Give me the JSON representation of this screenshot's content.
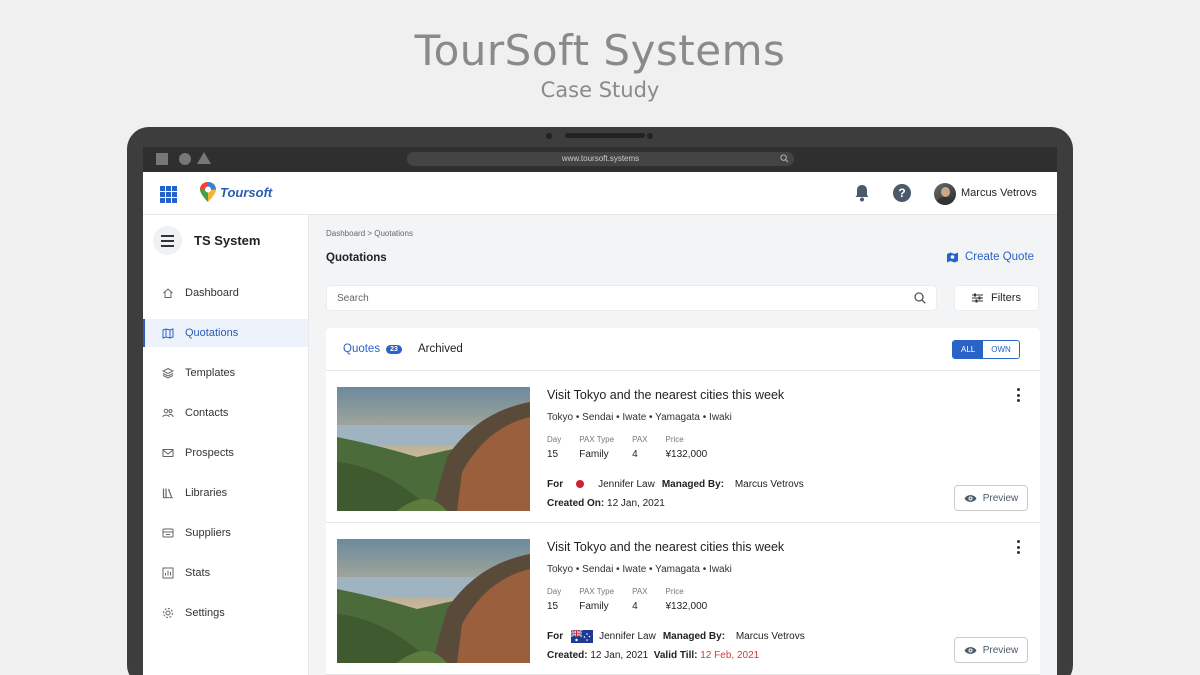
{
  "hero": {
    "title": "TourSoft Systems",
    "subtitle": "Case Study"
  },
  "browser": {
    "url": "www.toursoft.systems"
  },
  "appbar": {
    "logo_text": "Toursoft",
    "user_name": "Marcus Vetrovs",
    "help_label": "?"
  },
  "sidebar": {
    "title": "TS System",
    "items": [
      {
        "label": "Dashboard",
        "icon": "home-icon",
        "active": false
      },
      {
        "label": "Quotations",
        "icon": "map-icon",
        "active": true
      },
      {
        "label": "Templates",
        "icon": "layers-icon",
        "active": false
      },
      {
        "label": "Contacts",
        "icon": "users-icon",
        "active": false
      },
      {
        "label": "Prospects",
        "icon": "mail-icon",
        "active": false
      },
      {
        "label": "Libraries",
        "icon": "library-icon",
        "active": false
      },
      {
        "label": "Suppliers",
        "icon": "suppliers-icon",
        "active": false
      },
      {
        "label": "Stats",
        "icon": "stats-icon",
        "active": false
      },
      {
        "label": "Settings",
        "icon": "gear-icon",
        "active": false
      }
    ]
  },
  "main": {
    "breadcrumb": "Dashboard > Quotations",
    "title": "Quotations",
    "create_label": "Create Quote",
    "search_placeholder": "Search",
    "filters_label": "Filters",
    "tabs": {
      "quotes_label": "Quotes",
      "quotes_count": "23",
      "archived_label": "Archived"
    },
    "toggle": {
      "all": "ALL",
      "own": "OWN"
    },
    "cards": [
      {
        "title": "Visit Tokyo and the nearest cities this week",
        "route": "Tokyo  •  Sendai  •  Iwate  •  Yamagata  •  Iwaki",
        "stats": [
          {
            "label": "Day",
            "value": "15"
          },
          {
            "label": "PAX Type",
            "value": "Family"
          },
          {
            "label": "PAX",
            "value": "4"
          },
          {
            "label": "Price",
            "value": "¥132,000"
          }
        ],
        "for_label": "For",
        "client": "Jennifer Law",
        "flag": "japan",
        "managed_label": "Managed By:",
        "managed_by": "Marcus Vetrovs",
        "created_label": "Created On:",
        "created": "12 Jan, 2021",
        "valid_label": "",
        "valid_till": "",
        "preview_label": "Preview"
      },
      {
        "title": "Visit Tokyo and the nearest cities this week",
        "route": "Tokyo  •  Sendai  •  Iwate  •  Yamagata  •  Iwaki",
        "stats": [
          {
            "label": "Day",
            "value": "15"
          },
          {
            "label": "PAX Type",
            "value": "Family"
          },
          {
            "label": "PAX",
            "value": "4"
          },
          {
            "label": "Price",
            "value": "¥132,000"
          }
        ],
        "for_label": "For",
        "client": "Jennifer Law",
        "flag": "australia",
        "managed_label": "Managed By:",
        "managed_by": "Marcus Vetrovs",
        "created_label": "Created:",
        "created": "12 Jan, 2021",
        "valid_label": "Valid Till:",
        "valid_till": "12 Feb, 2021",
        "preview_label": "Preview"
      }
    ]
  },
  "colors": {
    "accent": "#2a63c8",
    "danger": "#d03a3a",
    "laptop": "#3d3d3d",
    "background": "#f0f0f0"
  }
}
